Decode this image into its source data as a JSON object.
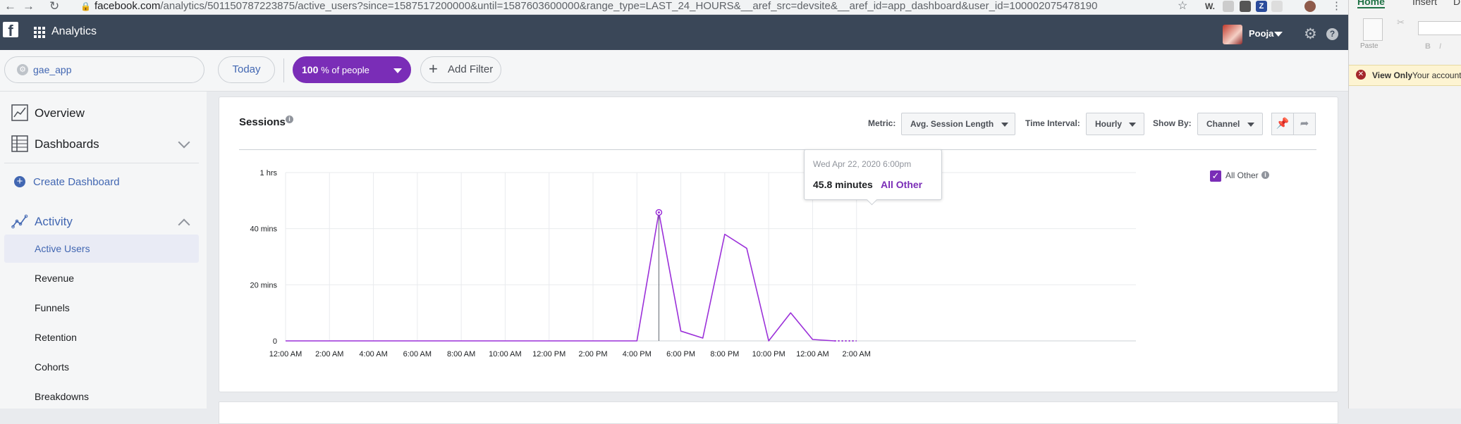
{
  "browser": {
    "url_main": "facebook.com",
    "url_rest": "/analytics/501150787223875/active_users?since=1587517200000&until=1587603600000&range_type=LAST_24_HOURS&__aref_src=devsite&__aref_id=app_dashboard&user_id=100002075478190",
    "ext_w": "W.",
    "ext_z": "Z"
  },
  "topbar": {
    "logo": "f",
    "title": "Analytics",
    "user_name": "Pooja",
    "help": "?"
  },
  "filters": {
    "app_name": "gae_app",
    "date_range": "Today",
    "people_value": "100",
    "people_suffix": "% of people",
    "add_filter": "Add Filter"
  },
  "sidebar": {
    "overview": "Overview",
    "dashboards": "Dashboards",
    "create_dashboard": "Create Dashboard",
    "activity": "Activity",
    "items": [
      "Active Users",
      "Revenue",
      "Funnels",
      "Retention",
      "Cohorts",
      "Breakdowns"
    ]
  },
  "card": {
    "title": "Sessions",
    "metric_label": "Metric:",
    "metric_value": "Avg. Session Length",
    "interval_label": "Time Interval:",
    "interval_value": "Hourly",
    "showby_label": "Show By:",
    "showby_value": "Channel"
  },
  "tooltip": {
    "date": "Wed Apr 22, 2020 6:00pm",
    "value": "45.8 minutes",
    "series": "All Other"
  },
  "colors": {
    "accent": "#7a2db7",
    "topbar": "#3a4758",
    "link": "#4267b2"
  },
  "chart_data": {
    "type": "line",
    "title": "Sessions",
    "x_tick_labels": [
      "12:00 AM",
      "2:00 AM",
      "4:00 AM",
      "6:00 AM",
      "8:00 AM",
      "10:00 AM",
      "12:00 PM",
      "2:00 PM",
      "4:00 PM",
      "6:00 PM",
      "8:00 PM",
      "10:00 PM",
      "12:00 AM",
      "2:00 AM"
    ],
    "y_tick_labels": [
      "0",
      "20 mins",
      "40 mins",
      "1 hrs"
    ],
    "ylim": [
      0,
      60
    ],
    "y_unit": "minutes",
    "grid": true,
    "legend": "right",
    "series": [
      {
        "name": "All Other",
        "color": "#9b30d9",
        "hour_index": [
          0,
          1,
          2,
          3,
          4,
          5,
          6,
          7,
          8,
          9,
          10,
          11,
          12,
          13,
          14,
          15,
          16,
          17,
          18,
          19,
          20,
          21,
          22,
          23,
          24,
          25,
          26
        ],
        "values": [
          0,
          0,
          0,
          0,
          0,
          0,
          0,
          0,
          0,
          0,
          0,
          0,
          0,
          0,
          0,
          0,
          0,
          45.8,
          3.5,
          1,
          38,
          33,
          0,
          10,
          0.5,
          0,
          0
        ],
        "dotted_from_index": 26
      }
    ],
    "highlight_index": 18
  },
  "excel": {
    "tab_home": "Home",
    "tab_insert": "Insert",
    "tab_draw": "Dra",
    "paste": "Paste",
    "view_only": "View Only",
    "account_msg": "Your account"
  }
}
